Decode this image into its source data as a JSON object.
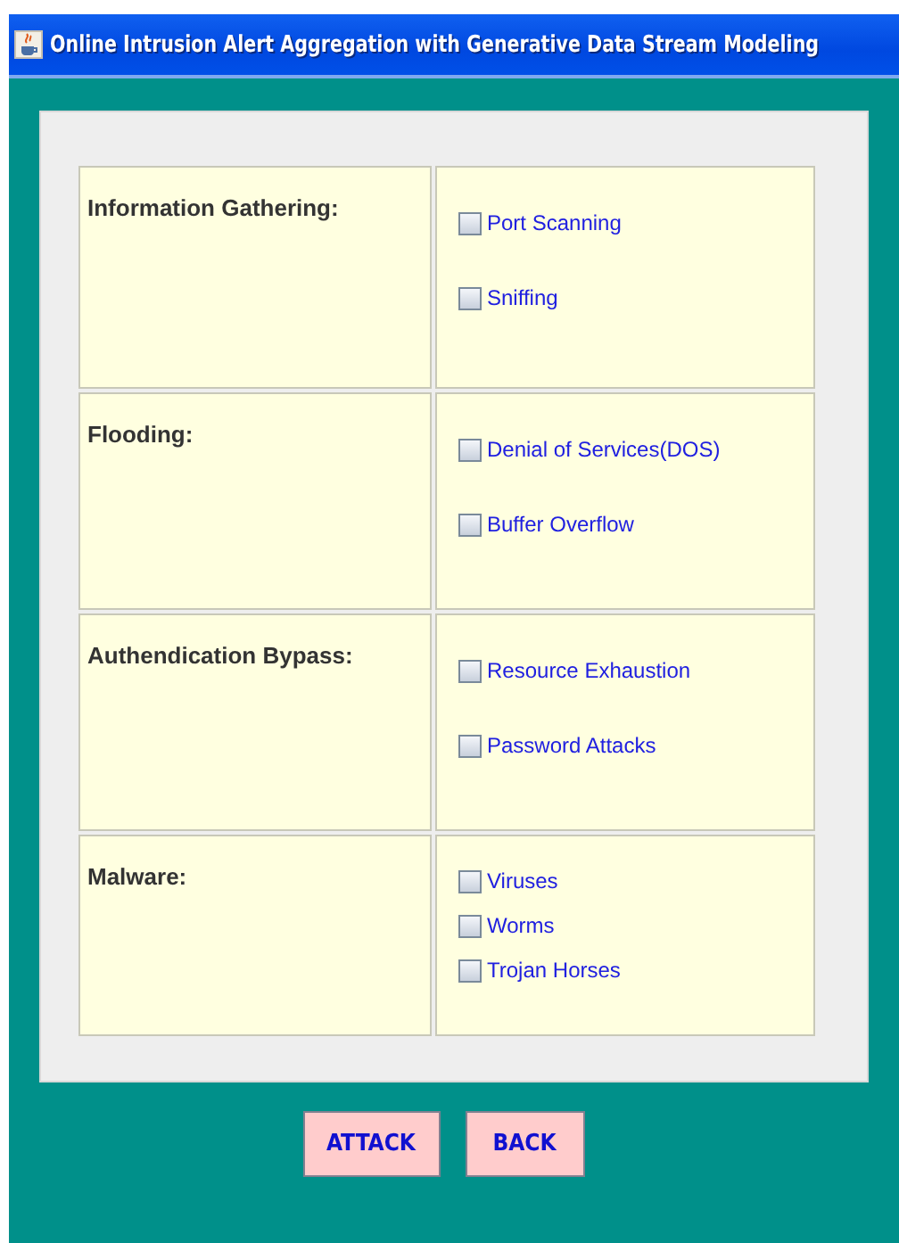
{
  "window": {
    "title": "Online Intrusion Alert Aggregation with Generative Data Stream Modeling"
  },
  "categories": [
    {
      "label": "Information Gathering:",
      "options": [
        {
          "label": "Port Scanning",
          "checked": false
        },
        {
          "label": "Sniffing",
          "checked": false
        }
      ]
    },
    {
      "label": "Flooding:",
      "options": [
        {
          "label": "Denial of Services(DOS)",
          "checked": false
        },
        {
          "label": "Buffer Overflow",
          "checked": false
        }
      ]
    },
    {
      "label": "Authendication Bypass:",
      "options": [
        {
          "label": "Resource Exhaustion",
          "checked": false
        },
        {
          "label": "Password Attacks",
          "checked": false
        }
      ]
    },
    {
      "label": "Malware:",
      "options": [
        {
          "label": "Viruses",
          "checked": false
        },
        {
          "label": "Worms",
          "checked": false
        },
        {
          "label": "Trojan Horses",
          "checked": false
        }
      ]
    }
  ],
  "buttons": [
    "ATTACK",
    "BACK"
  ]
}
